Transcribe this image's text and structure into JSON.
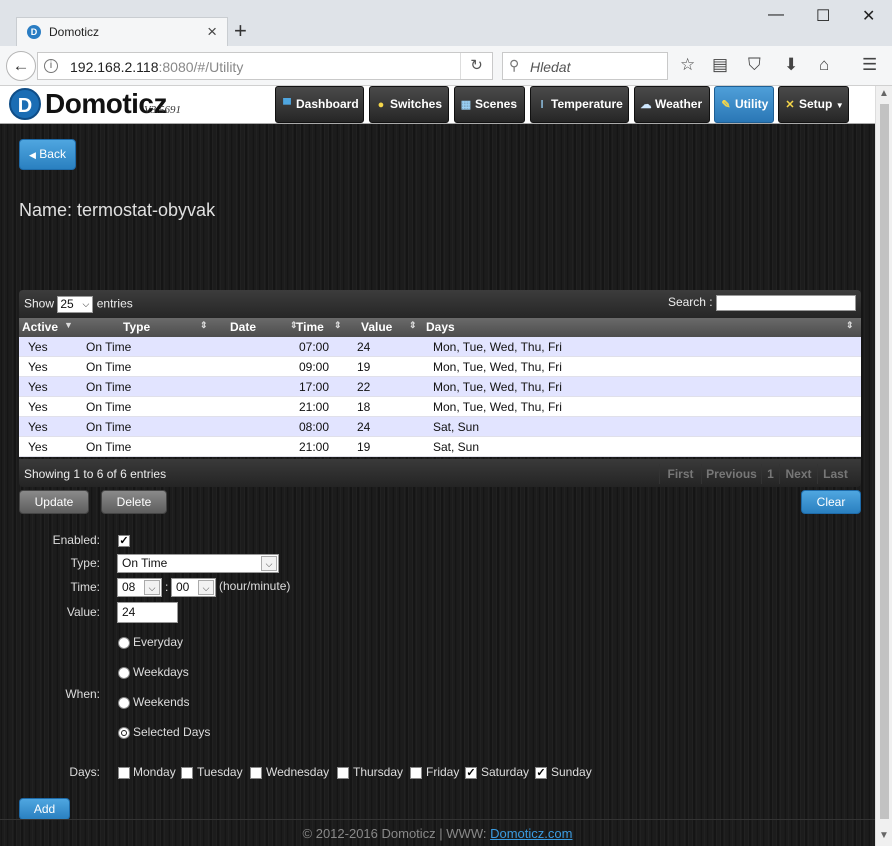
{
  "browser": {
    "tab_title": "Domoticz",
    "url_main": "192.168.2.118",
    "url_rest": ":8080/#/Utility",
    "search_placeholder": "Hledat"
  },
  "app": {
    "logo": "Domoticz",
    "version": "V3.5691",
    "nav": [
      {
        "label": "Dashboard",
        "icon": "monitor-icon"
      },
      {
        "label": "Switches",
        "icon": "lightbulb-icon"
      },
      {
        "label": "Scenes",
        "icon": "clapperboard-icon"
      },
      {
        "label": "Temperature",
        "icon": "thermometer-icon"
      },
      {
        "label": "Weather",
        "icon": "cloud-rain-icon"
      },
      {
        "label": "Utility",
        "icon": "pencil-icon"
      },
      {
        "label": "Setup",
        "icon": "tools-icon"
      }
    ]
  },
  "back_label": "Back",
  "device_name": "Name: termostat-obyvak",
  "table": {
    "show_label": "Show",
    "show_value": "25",
    "entries_label": "entries",
    "search_label": "Search :",
    "columns": [
      "Active",
      "Type",
      "Date",
      "Time",
      "Value",
      "Days"
    ],
    "rows": [
      {
        "active": "Yes",
        "type": "On Time",
        "date": "",
        "time": "07:00",
        "value": "24",
        "days": "Mon, Tue, Wed, Thu, Fri"
      },
      {
        "active": "Yes",
        "type": "On Time",
        "date": "",
        "time": "09:00",
        "value": "19",
        "days": "Mon, Tue, Wed, Thu, Fri"
      },
      {
        "active": "Yes",
        "type": "On Time",
        "date": "",
        "time": "17:00",
        "value": "22",
        "days": "Mon, Tue, Wed, Thu, Fri"
      },
      {
        "active": "Yes",
        "type": "On Time",
        "date": "",
        "time": "21:00",
        "value": "18",
        "days": "Mon, Tue, Wed, Thu, Fri"
      },
      {
        "active": "Yes",
        "type": "On Time",
        "date": "",
        "time": "08:00",
        "value": "24",
        "days": "Sat, Sun"
      },
      {
        "active": "Yes",
        "type": "On Time",
        "date": "",
        "time": "21:00",
        "value": "19",
        "days": "Sat, Sun"
      }
    ],
    "info": "Showing 1 to 6 of 6 entries",
    "pager": [
      "First",
      "Previous",
      "1",
      "Next",
      "Last"
    ]
  },
  "buttons": {
    "update": "Update",
    "delete": "Delete",
    "clear": "Clear",
    "add": "Add"
  },
  "form": {
    "enabled_label": "Enabled:",
    "enabled": true,
    "type_label": "Type:",
    "type_value": "On Time",
    "time_label": "Time:",
    "hour": "08",
    "minute": "00",
    "time_sep": ":",
    "time_hint": "(hour/minute)",
    "value_label": "Value:",
    "value": "24",
    "when_label": "When:",
    "when_options": [
      "Everyday",
      "Weekdays",
      "Weekends",
      "Selected Days"
    ],
    "when_selected": "Selected Days",
    "days_label": "Days:",
    "days": [
      {
        "label": "Monday",
        "checked": false
      },
      {
        "label": "Tuesday",
        "checked": false
      },
      {
        "label": "Wednesday",
        "checked": false
      },
      {
        "label": "Thursday",
        "checked": false
      },
      {
        "label": "Friday",
        "checked": false
      },
      {
        "label": "Saturday",
        "checked": true
      },
      {
        "label": "Sunday",
        "checked": true
      }
    ]
  },
  "footer": {
    "text": "© 2012-2016 Domoticz | WWW: ",
    "link": "Domoticz.com"
  }
}
